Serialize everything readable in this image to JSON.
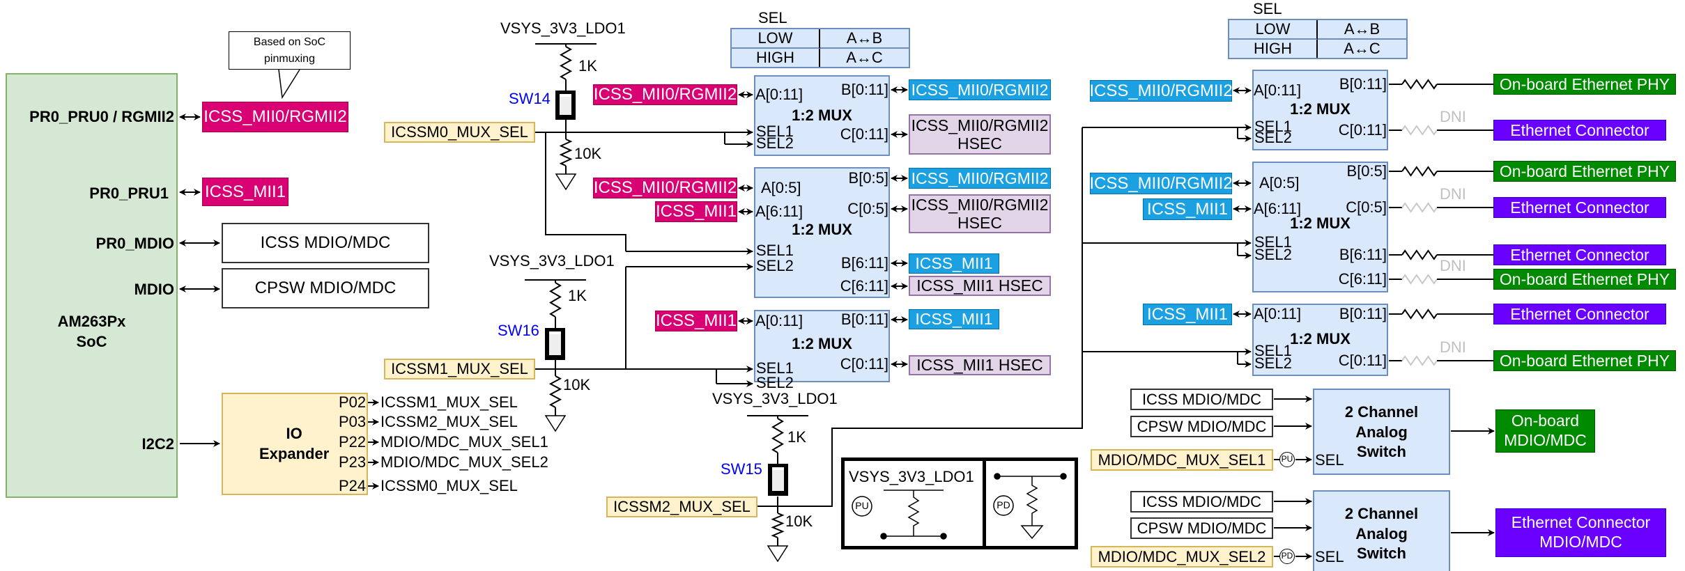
{
  "soc": {
    "name_line1": "AM263Px",
    "name_line2": "SoC",
    "pins": [
      "PR0_PRU0 / RGMII2",
      "PR0_PRU1",
      "PR0_MDIO",
      "MDIO",
      "I2C2"
    ]
  },
  "callout": {
    "line1": "Based on SoC",
    "line2": "pinmuxing"
  },
  "soc_outputs": {
    "pru0": "ICSS_MII0/RGMII2",
    "pru1": "ICSS_MII1",
    "icss_mdio": "ICSS MDIO/MDC",
    "cpsw_mdio": "CPSW MDIO/MDC"
  },
  "io_expander": {
    "title_line1": "IO",
    "title_line2": "Expander",
    "pins": [
      {
        "pin": "P02",
        "signal": "ICSSM1_MUX_SEL"
      },
      {
        "pin": "P03",
        "signal": "ICSSM2_MUX_SEL"
      },
      {
        "pin": "P22",
        "signal": "MDIO/MDC_MUX_SEL1"
      },
      {
        "pin": "P23",
        "signal": "MDIO/MDC_MUX_SEL2"
      },
      {
        "pin": "P24",
        "signal": "ICSSM0_MUX_SEL"
      }
    ]
  },
  "power_rail": "VSYS_3V3_LDO1",
  "resistors": {
    "pullup": "1K",
    "pulldown": "10K"
  },
  "switches": [
    {
      "name": "SW14",
      "net": "ICSSM0_MUX_SEL"
    },
    {
      "name": "SW16",
      "net": "ICSSM1_MUX_SEL"
    },
    {
      "name": "SW15",
      "net": "ICSSM2_MUX_SEL"
    }
  ],
  "sel_table": {
    "title": "SEL",
    "rows": [
      {
        "level": "LOW",
        "path": "A↔B"
      },
      {
        "level": "HIGH",
        "path": "A↔C"
      }
    ]
  },
  "mux_title": "1:2 MUX",
  "sel_pins": [
    "SEL1",
    "SEL2"
  ],
  "left_muxes": [
    {
      "a_ports": [
        {
          "port": "A[0:11]",
          "signal": "ICSS_MII0/RGMII2"
        }
      ],
      "outputs": [
        {
          "port": "B[0:11]",
          "signal": "ICSS_MII0/RGMII2"
        },
        {
          "port": "C[0:11]",
          "signal": "ICSS_MII0/RGMII2 HSEC"
        }
      ]
    },
    {
      "a_ports": [
        {
          "port": "A[0:5]",
          "signal": "ICSS_MII0/RGMII2"
        },
        {
          "port": "A[6:11]",
          "signal": "ICSS_MII1"
        }
      ],
      "outputs": [
        {
          "port": "B[0:5]",
          "signal": "ICSS_MII0/RGMII2"
        },
        {
          "port": "C[0:5]",
          "signal": "ICSS_MII0/RGMII2 HSEC"
        },
        {
          "port": "B[6:11]",
          "signal": "ICSS_MII1"
        },
        {
          "port": "C[6:11]",
          "signal": "ICSS_MII1 HSEC"
        }
      ]
    },
    {
      "a_ports": [
        {
          "port": "A[0:11]",
          "signal": "ICSS_MII1"
        }
      ],
      "outputs": [
        {
          "port": "B[0:11]",
          "signal": "ICSS_MII1"
        },
        {
          "port": "C[0:11]",
          "signal": "ICSS_MII1 HSEC"
        }
      ]
    }
  ],
  "hsec_line1": "ICSS_MII0/RGMII2",
  "hsec_line2": "HSEC",
  "right_muxes": [
    {
      "a_ports": [
        {
          "port": "A[0:11]",
          "signal": "ICSS_MII0/RGMII2"
        }
      ],
      "outputs": [
        {
          "port": "B[0:11]",
          "dest": "On-board Ethernet PHY",
          "dni": false
        },
        {
          "port": "C[0:11]",
          "dest": "Ethernet Connector",
          "dni": true
        }
      ]
    },
    {
      "a_ports": [
        {
          "port": "A[0:5]",
          "signal": "ICSS_MII0/RGMII2"
        },
        {
          "port": "A[6:11]",
          "signal": "ICSS_MII1"
        }
      ],
      "outputs": [
        {
          "port": "B[0:5]",
          "dest": "On-board Ethernet PHY",
          "dni": false
        },
        {
          "port": "C[0:5]",
          "dest": "Ethernet Connector",
          "dni": true
        },
        {
          "port": "B[6:11]",
          "dest": "Ethernet Connector",
          "dni": false
        },
        {
          "port": "C[6:11]",
          "dest": "On-board Ethernet PHY",
          "dni": true
        }
      ]
    },
    {
      "a_ports": [
        {
          "port": "A[0:11]",
          "signal": "ICSS_MII1"
        }
      ],
      "outputs": [
        {
          "port": "B[0:11]",
          "dest": "Ethernet Connector",
          "dni": false
        },
        {
          "port": "C[0:11]",
          "dest": "On-board Ethernet PHY",
          "dni": true
        }
      ]
    }
  ],
  "dni_label": "DNI",
  "analog_switches": [
    {
      "title_line1": "2 Channel",
      "title_line2": "Analog",
      "title_line3": "Switch",
      "inputs": [
        "ICSS MDIO/MDC",
        "CPSW MDIO/MDC"
      ],
      "sel_signal": "MDIO/MDC_MUX_SEL1",
      "sel_bias": "PU",
      "sel_pin": "SEL",
      "output_line1": "On-board",
      "output_line2": "MDIO/MDC"
    },
    {
      "title_line1": "2 Channel",
      "title_line2": "Analog",
      "title_line3": "Switch",
      "inputs": [
        "ICSS MDIO/MDC",
        "CPSW MDIO/MDC"
      ],
      "sel_signal": "MDIO/MDC_MUX_SEL2",
      "sel_bias": "PD",
      "sel_pin": "SEL",
      "output_line1": "Ethernet Connector",
      "output_line2": "MDIO/MDC"
    }
  ],
  "legend": {
    "pu_rail": "VSYS_3V3_LDO1",
    "pu": "PU",
    "pd": "PD"
  },
  "colors": {
    "soc_fill": "#d5e8d4",
    "icss_magenta": "#d80073",
    "icss_blue": "#1ba1e2",
    "hsec_lavender": "#e1d5e7",
    "phy_green": "#008a00",
    "connector_purple": "#6a00ff",
    "mux_blue": "#dae8fc",
    "sel_yellow": "#fff2cc",
    "switch_label_blue": "#0000ff"
  }
}
